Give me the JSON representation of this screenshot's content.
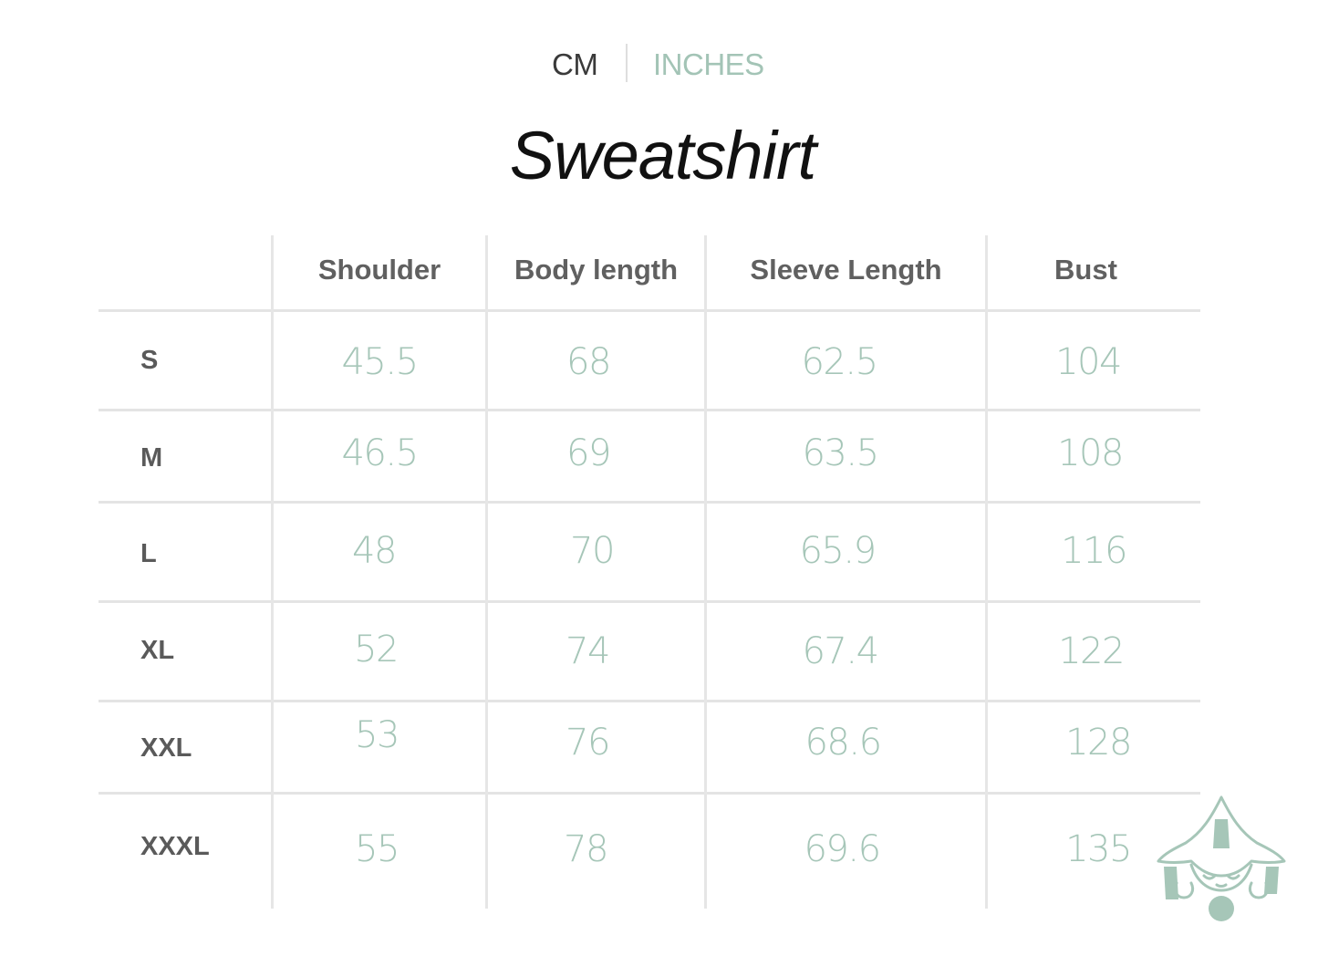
{
  "units": {
    "cm": "CM",
    "inches": "INCHES"
  },
  "title": "Sweatshirt",
  "table": {
    "headers": [
      "Shoulder",
      "Body length",
      "Sleeve Length",
      "Bust"
    ],
    "rows": [
      {
        "size": "S",
        "values": [
          "45.5",
          "68",
          "62.5",
          "104"
        ]
      },
      {
        "size": "M",
        "values": [
          "46.5",
          "69",
          "63.5",
          "108"
        ]
      },
      {
        "size": "L",
        "values": [
          "48",
          "70",
          "65.9",
          "116"
        ]
      },
      {
        "size": "XL",
        "values": [
          "52",
          "74",
          "67.4",
          "122"
        ]
      },
      {
        "size": "XXL",
        "values": [
          "53",
          "76",
          "68.6",
          "128"
        ]
      },
      {
        "size": "XXXL",
        "values": [
          "55",
          "78",
          "69.6",
          "135"
        ]
      }
    ]
  },
  "colors": {
    "accent": "#a6c6b8",
    "header_text": "#606060",
    "title_text": "#111111",
    "grid": "#e4e4e4"
  },
  "icons": [
    "mascot-icon"
  ]
}
